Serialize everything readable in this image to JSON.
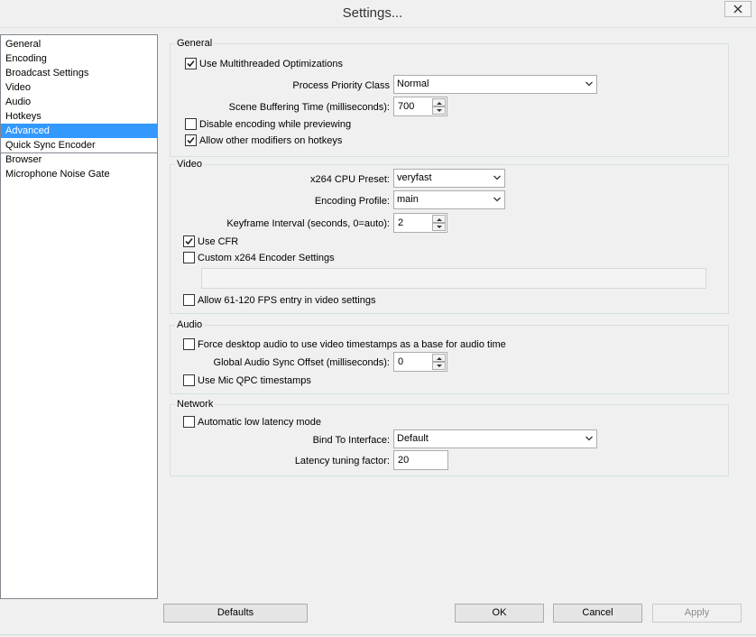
{
  "window": {
    "title": "Settings..."
  },
  "sidebar": {
    "items": [
      {
        "label": "General"
      },
      {
        "label": "Encoding"
      },
      {
        "label": "Broadcast Settings"
      },
      {
        "label": "Video"
      },
      {
        "label": "Audio"
      },
      {
        "label": "Hotkeys"
      },
      {
        "label": "Advanced"
      },
      {
        "label": "Quick Sync Encoder"
      },
      {
        "label": "Browser"
      },
      {
        "label": "Microphone Noise Gate"
      }
    ],
    "selected": "Advanced"
  },
  "general": {
    "title": "General",
    "multithreaded": {
      "label": "Use Multithreaded Optimizations",
      "checked": true
    },
    "priority": {
      "label": "Process Priority Class",
      "value": "Normal"
    },
    "buffering": {
      "label": "Scene Buffering Time (milliseconds):",
      "value": "700"
    },
    "disable_encoding": {
      "label": "Disable encoding while previewing",
      "checked": false
    },
    "allow_modifiers": {
      "label": "Allow other modifiers on hotkeys",
      "checked": true
    }
  },
  "video": {
    "title": "Video",
    "cpu_preset": {
      "label": "x264 CPU Preset:",
      "value": "veryfast"
    },
    "profile": {
      "label": "Encoding Profile:",
      "value": "main"
    },
    "keyframe": {
      "label": "Keyframe Interval (seconds, 0=auto):",
      "value": "2"
    },
    "use_cfr": {
      "label": "Use CFR",
      "checked": true
    },
    "custom_x264": {
      "label": "Custom x264 Encoder Settings",
      "checked": false,
      "value": ""
    },
    "allow_fps": {
      "label": "Allow 61-120 FPS entry in video settings",
      "checked": false
    }
  },
  "audio": {
    "title": "Audio",
    "force_desktop": {
      "label": "Force desktop audio to use video timestamps as a base for audio time",
      "checked": false
    },
    "sync_offset": {
      "label": "Global Audio Sync Offset (milliseconds):",
      "value": "0"
    },
    "mic_qpc": {
      "label": "Use Mic QPC timestamps",
      "checked": false
    }
  },
  "network": {
    "title": "Network",
    "low_latency": {
      "label": "Automatic low latency mode",
      "checked": false
    },
    "bind_interface": {
      "label": "Bind To Interface:",
      "value": "Default"
    },
    "latency_factor": {
      "label": "Latency tuning factor:",
      "value": "20"
    }
  },
  "buttons": {
    "defaults": "Defaults",
    "ok": "OK",
    "cancel": "Cancel",
    "apply": "Apply"
  }
}
